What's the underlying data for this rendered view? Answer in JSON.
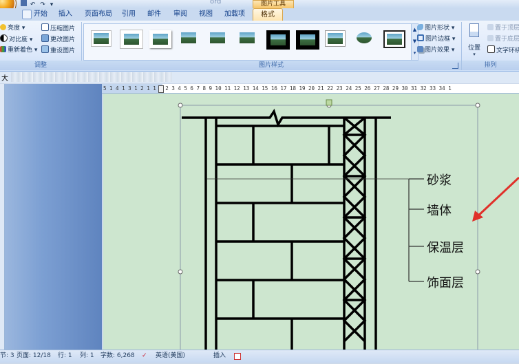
{
  "title_bar": {
    "doc_title": "ord",
    "context_tab_title": "图片工具"
  },
  "tabs": [
    {
      "label": "开始"
    },
    {
      "label": "插入"
    },
    {
      "label": "页面布局"
    },
    {
      "label": "引用"
    },
    {
      "label": "邮件"
    },
    {
      "label": "审阅"
    },
    {
      "label": "视图"
    },
    {
      "label": "加载项"
    },
    {
      "label": "格式",
      "selected": true
    }
  ],
  "ribbon": {
    "adjust": {
      "label": "调整",
      "items": [
        "亮度",
        "对比度",
        "重新着色",
        "压缩图片",
        "更改图片",
        "重设图片"
      ]
    },
    "picture_styles": {
      "label": "图片样式",
      "styles_count": 11,
      "side_items": [
        "图片形状",
        "图片边框",
        "图片效果"
      ]
    },
    "arrange": {
      "label": "排列",
      "position_label": "位置",
      "items": [
        "置于顶层",
        "置于底层",
        "文字环绕"
      ]
    }
  },
  "document_bar": {
    "first_char": "大"
  },
  "ruler": {
    "text": "5 1 4 1 3 1 2 1 1   1   2  3  4  5  6  7  8  9  10 11 12 13 14 15 16 17 18 19 20 21 22 23 24 25 26 27 28 29 30 31 32 33 34 1"
  },
  "diagram": {
    "labels": [
      "砂浆",
      "墙体",
      "保温层",
      "饰面层"
    ]
  },
  "status_bar": {
    "section": "节: 3",
    "page": "页面: 12/18",
    "line": "行: 1",
    "column": "列: 1",
    "word_count": "字数: 6,268",
    "language": "英语(美国)",
    "mode": "插入"
  },
  "colors": {
    "document_background": "#cde6cf",
    "selected_tab": "#fde3ad",
    "ribbon": "#dfeafb",
    "arrow": "#e0302a"
  }
}
